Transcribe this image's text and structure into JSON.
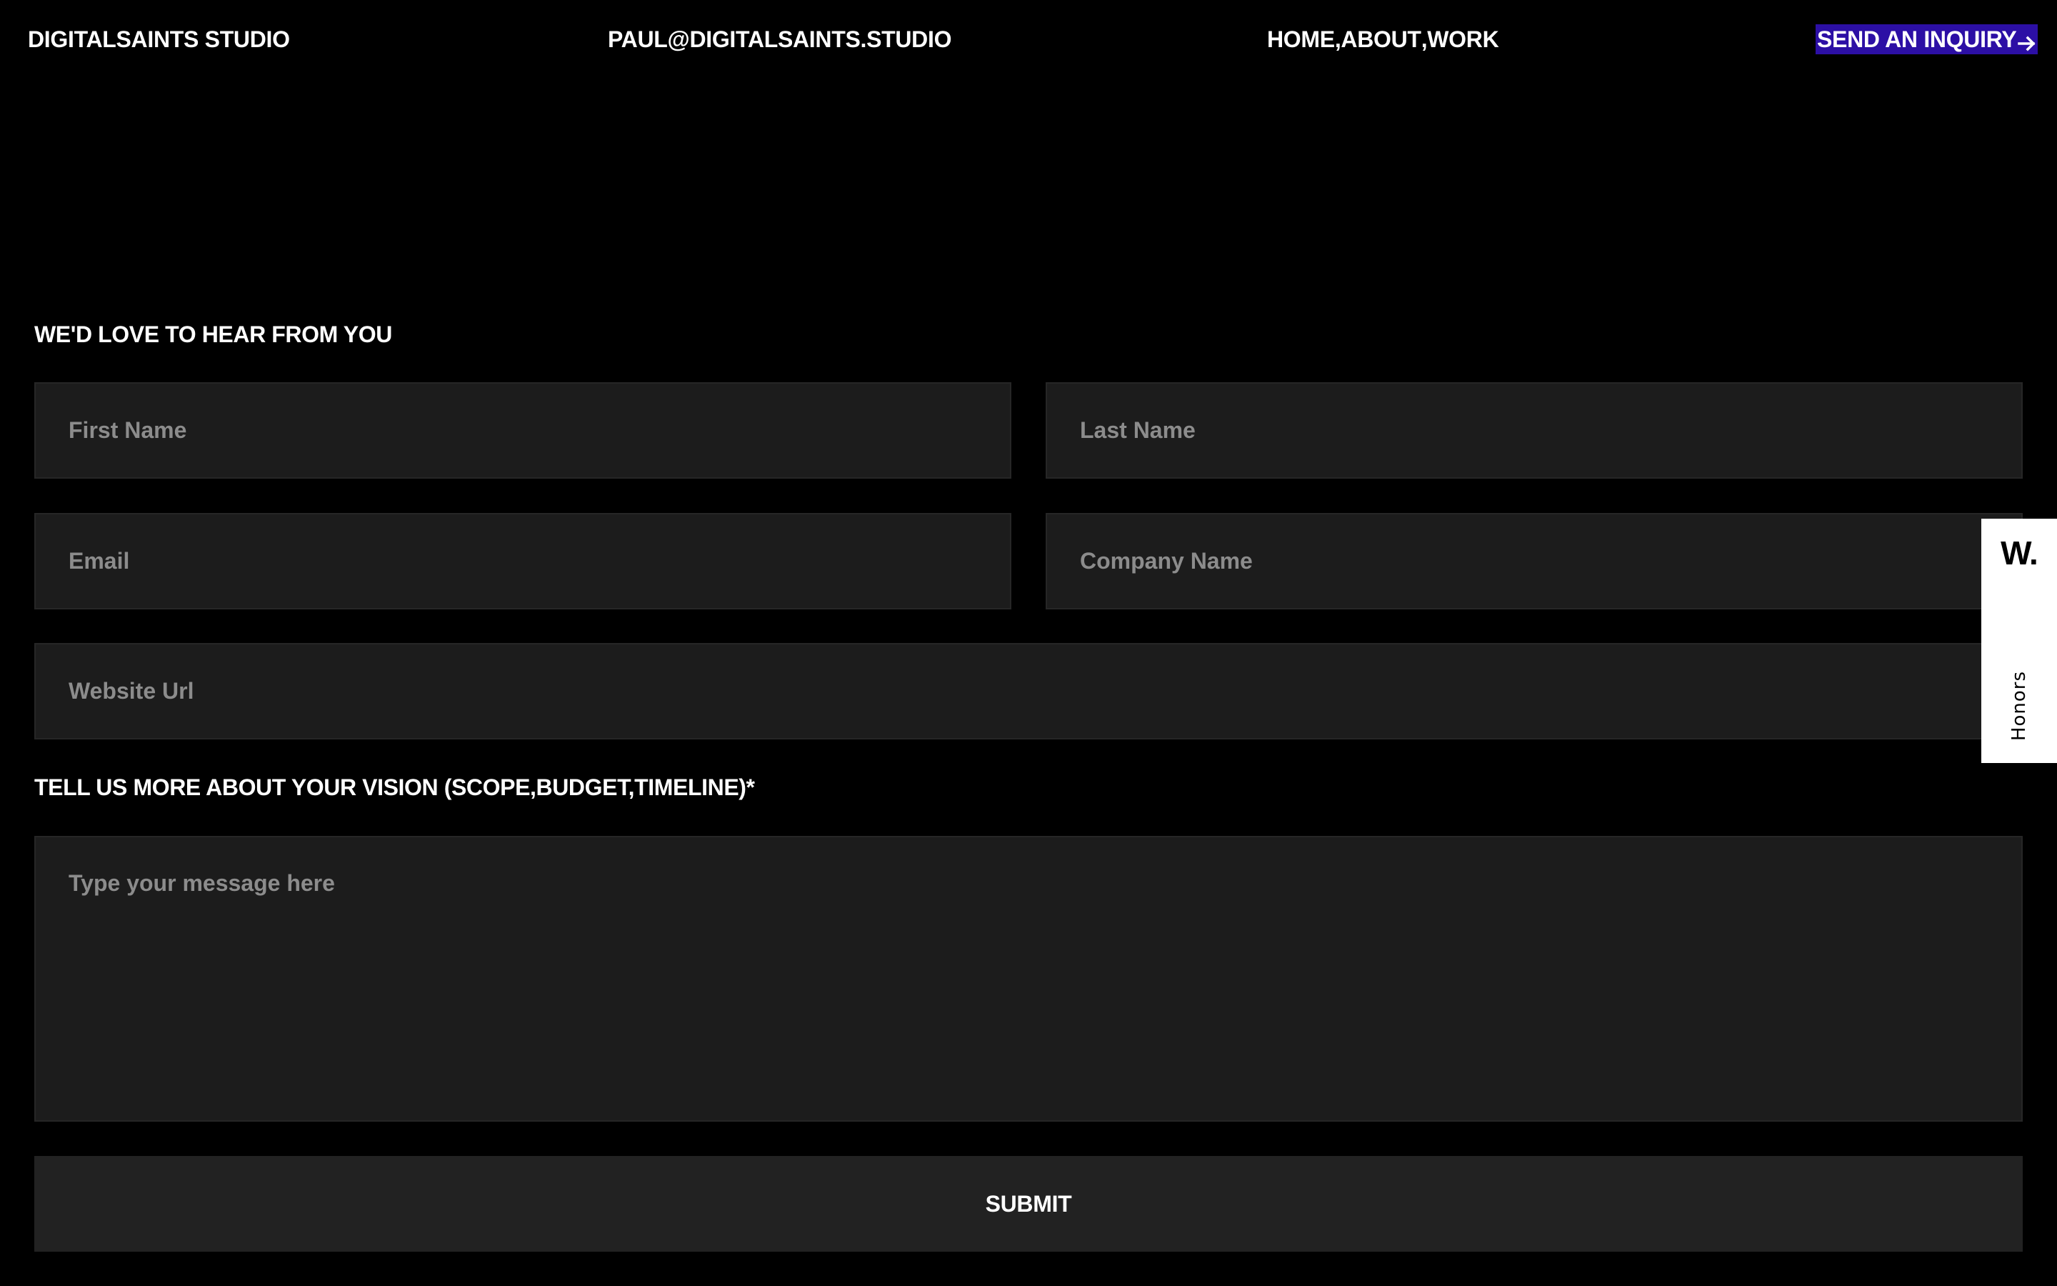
{
  "header": {
    "brand": "DIGITALSAINTS STUDIO",
    "email": "PAUL@DIGITALSAINTS.STUDIO",
    "nav": [
      {
        "label": "HOME"
      },
      {
        "label": "ABOUT"
      },
      {
        "label": "WORK"
      }
    ],
    "nav_separator": ",",
    "cta_label": "SEND AN INQUIRY",
    "cta_icon": "arrow-right-icon",
    "cta_color": "#2c0fa5"
  },
  "form": {
    "heading": "WE'D LOVE TO HEAR FROM YOU",
    "first_name": {
      "placeholder": "First Name",
      "value": ""
    },
    "last_name": {
      "placeholder": "Last Name",
      "value": ""
    },
    "email": {
      "placeholder": "Email",
      "value": ""
    },
    "company": {
      "placeholder": "Company Name",
      "value": ""
    },
    "website": {
      "placeholder": "Website Url",
      "value": ""
    },
    "vision_heading": "TELL US MORE ABOUT YOUR VISION (SCOPE,BUDGET,TIMELINE)*",
    "message": {
      "placeholder": "Type your message here",
      "value": ""
    },
    "submit_label": "SUBMIT"
  },
  "badge": {
    "logo": "W.",
    "label": "Honors"
  },
  "colors": {
    "background": "#000000",
    "field_background": "#1c1c1c",
    "button_background": "#222222",
    "placeholder": "#8c8c8c",
    "text": "#ffffff"
  }
}
